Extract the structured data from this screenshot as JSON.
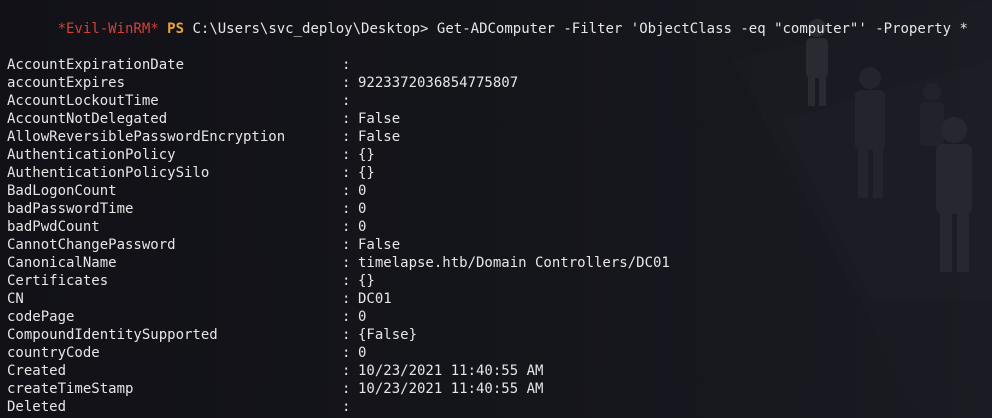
{
  "prompt": {
    "prefix": "*Evil-WinRM*",
    "ps": "PS",
    "path": "C:\\Users\\svc_deploy\\Desktop>",
    "command": "Get-ADComputer -Filter 'ObjectClass -eq \"computer\"' -Property *"
  },
  "separator": ":",
  "properties": [
    {
      "key": "AccountExpirationDate",
      "value": ""
    },
    {
      "key": "accountExpires",
      "value": "9223372036854775807"
    },
    {
      "key": "AccountLockoutTime",
      "value": ""
    },
    {
      "key": "AccountNotDelegated",
      "value": "False"
    },
    {
      "key": "AllowReversiblePasswordEncryption",
      "value": "False"
    },
    {
      "key": "AuthenticationPolicy",
      "value": "{}"
    },
    {
      "key": "AuthenticationPolicySilo",
      "value": "{}"
    },
    {
      "key": "BadLogonCount",
      "value": "0"
    },
    {
      "key": "badPasswordTime",
      "value": "0"
    },
    {
      "key": "badPwdCount",
      "value": "0"
    },
    {
      "key": "CannotChangePassword",
      "value": "False"
    },
    {
      "key": "CanonicalName",
      "value": "timelapse.htb/Domain Controllers/DC01"
    },
    {
      "key": "Certificates",
      "value": "{}"
    },
    {
      "key": "CN",
      "value": "DC01"
    },
    {
      "key": "codePage",
      "value": "0"
    },
    {
      "key": "CompoundIdentitySupported",
      "value": "{False}"
    },
    {
      "key": "countryCode",
      "value": "0"
    },
    {
      "key": "Created",
      "value": "10/23/2021 11:40:55 AM"
    },
    {
      "key": "createTimeStamp",
      "value": "10/23/2021 11:40:55 AM"
    },
    {
      "key": "Deleted",
      "value": ""
    }
  ]
}
